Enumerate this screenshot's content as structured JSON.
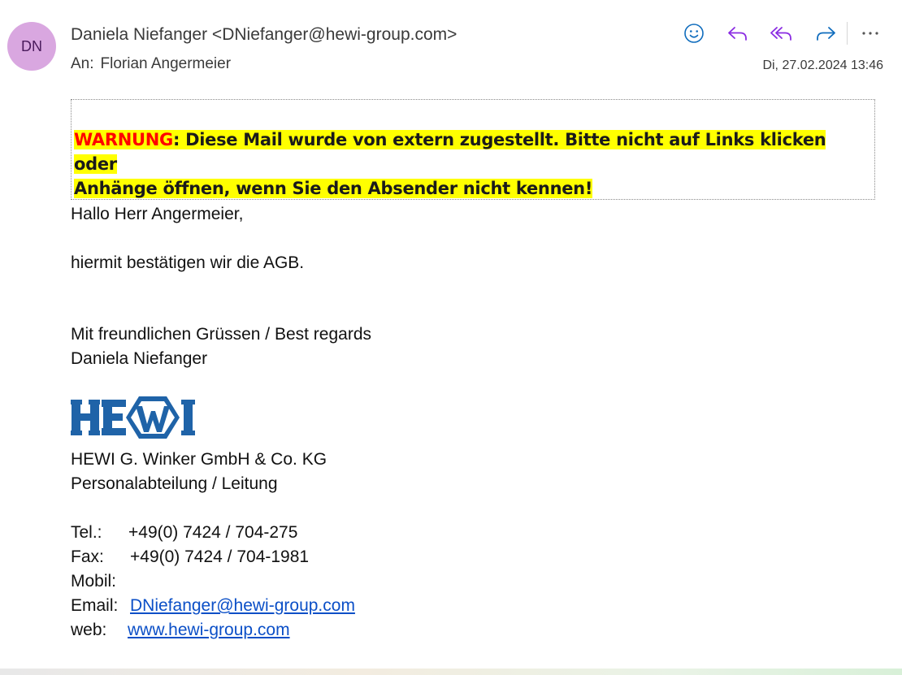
{
  "header": {
    "avatar_initials": "DN",
    "from": "Daniela Niefanger <DNiefanger@hewi-group.com>",
    "to_label": "An:",
    "to": "Florian Angermeier",
    "date": "Di, 27.02.2024 13:46",
    "actions": [
      {
        "icon": "smiley-icon",
        "color": "#0f6cbd"
      },
      {
        "icon": "reply-icon",
        "color": "#8a2be2"
      },
      {
        "icon": "reply-all-icon",
        "color": "#8a2be2"
      },
      {
        "icon": "forward-icon",
        "color": "#0f6cbd"
      },
      {
        "icon": "more-icon",
        "color": "#555555"
      }
    ]
  },
  "warning": {
    "label": "WARNUNG",
    "text_line1": ": Diese Mail wurde von extern zugestellt. Bitte nicht auf Links klicken oder",
    "text_line2": "Anhänge öffnen, wenn Sie den Absender nicht kennen!",
    "highlight_color": "#ffff00",
    "label_color": "#ff0000"
  },
  "body": {
    "greeting": "Hallo Herr Angermeier,",
    "message": "hiermit bestätigen wir die AGB.",
    "closing": "Mit freundlichen Grüssen / Best regards",
    "signature_name": "Daniela Niefanger"
  },
  "signature": {
    "logo_text": "HEWI",
    "company": "HEWI G. Winker GmbH & Co. KG",
    "department": "Personalabteilung / Leitung",
    "tel_label": "Tel.:",
    "tel": "+49(0) 7424 / 704-275",
    "fax_label": "Fax:",
    "fax": "+49(0) 7424 / 704-1981",
    "mobil_label": "Mobil:",
    "email_label": "Email:",
    "email": "DNiefanger@hewi-group.com",
    "web_label": "web:",
    "web": "www.hewi-group.com"
  }
}
